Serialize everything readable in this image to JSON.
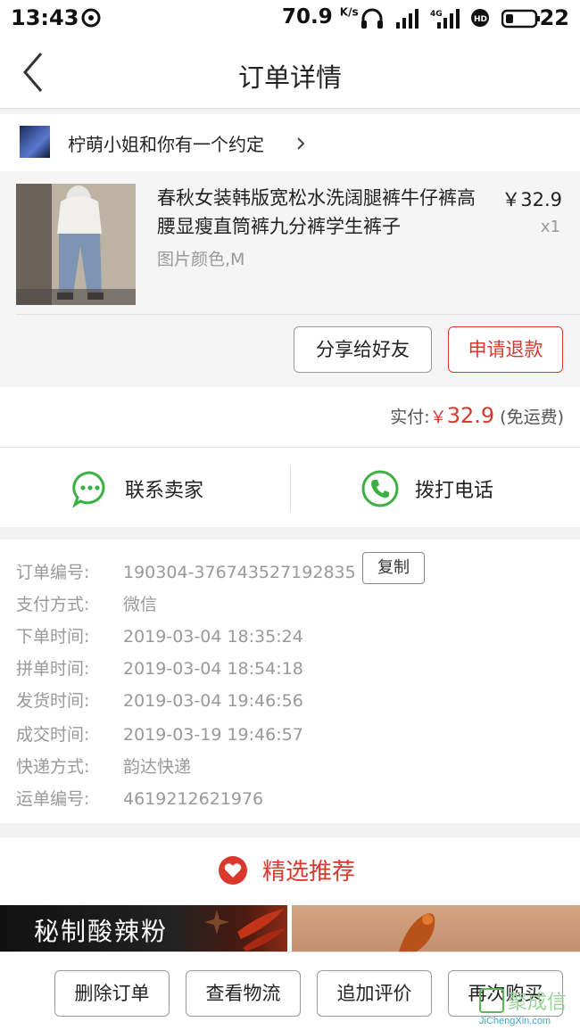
{
  "status_bar": {
    "time": "13:43",
    "speed": "70.9",
    "speed_unit": "K/s",
    "battery": "22"
  },
  "header": {
    "title": "订单详情"
  },
  "shop": {
    "name": "柠萌小姐和你有一个约定"
  },
  "product": {
    "title": "春秋女装韩版宽松水洗阔腿裤牛仔裤高腰显瘦直筒裤九分裤学生裤子",
    "price": "￥32.9",
    "qty": "x1",
    "sku": "图片颜色,M",
    "share_label": "分享给好友",
    "refund_label": "申请退款"
  },
  "total": {
    "label": "实付:",
    "currency": "￥",
    "amount": "32.9",
    "note": "(免运费)"
  },
  "contact": {
    "seller_label": "联系卖家",
    "phone_label": "拨打电话"
  },
  "order_info": {
    "copy_label": "复制",
    "rows": [
      {
        "key": "订单编号:",
        "value": "190304-376743527192835"
      },
      {
        "key": "支付方式:",
        "value": "微信"
      },
      {
        "key": "下单时间:",
        "value": "2019-03-04 18:35:24"
      },
      {
        "key": "拼单时间:",
        "value": "2019-03-04 18:54:18"
      },
      {
        "key": "发货时间:",
        "value": "2019-03-04 19:46:56"
      },
      {
        "key": "成交时间:",
        "value": "2019-03-19 19:46:57"
      },
      {
        "key": "快递方式:",
        "value": "韵达快递"
      },
      {
        "key": "运单编号:",
        "value": "4619212621976"
      }
    ]
  },
  "recommend": {
    "title": "精选推荐",
    "banner_text": "秘制酸辣粉"
  },
  "bottom_bar": {
    "delete_label": "删除订单",
    "logistics_label": "查看物流",
    "review_label": "追加评价",
    "rebuy_label": "再次购买"
  },
  "watermark": {
    "cn": "聚成信",
    "en": "JiChengXin.com"
  },
  "colors": {
    "accent": "#d9382d",
    "wechat_green": "#3cb043"
  }
}
